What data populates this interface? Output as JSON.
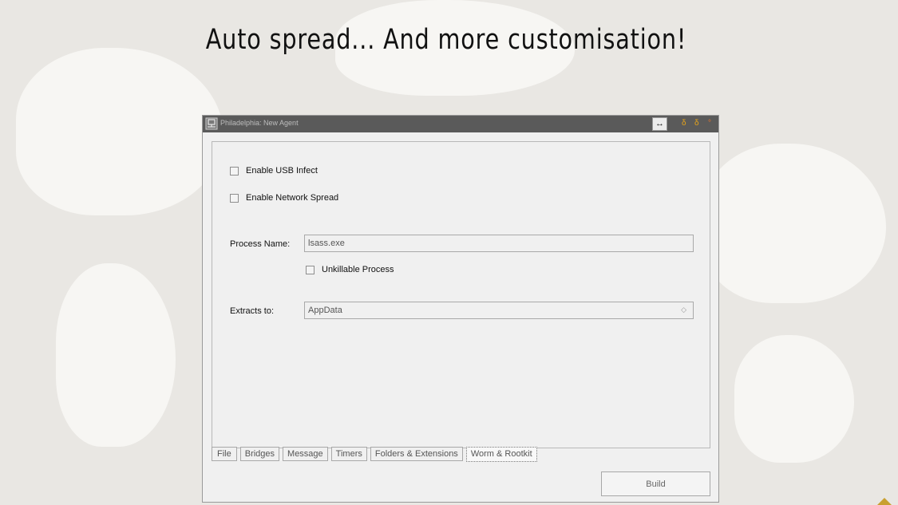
{
  "slide": {
    "title": "Auto spread... And more customisation!"
  },
  "window": {
    "title": "Philadelphia: New Agent",
    "resize_glyph": "↔",
    "min_glyph": "δ",
    "max_glyph": "δ",
    "close_glyph": "°"
  },
  "form": {
    "usb_label": "Enable USB Infect",
    "usb_checked": false,
    "network_label": "Enable Network Spread",
    "network_checked": false,
    "process_name_label": "Process Name:",
    "process_name_value": "lsass.exe",
    "unkillable_label": "Unkillable Process",
    "unkillable_checked": false,
    "extracts_label": "Extracts to:",
    "extracts_value": "AppData",
    "dropdown_arrow": "◇"
  },
  "tabs": [
    {
      "label": "File",
      "active": false
    },
    {
      "label": "Bridges",
      "active": false
    },
    {
      "label": "Message",
      "active": false
    },
    {
      "label": "Timers",
      "active": false
    },
    {
      "label": "Folders & Extensions",
      "active": false
    },
    {
      "label": "Worm & Rootkit",
      "active": true
    }
  ],
  "footer": {
    "build_label": "Build"
  },
  "icons": {
    "app": "app-icon",
    "checkbox": "checkbox-icon",
    "dropdown": "chevron-down-icon",
    "resize": "resize-icon",
    "decoration": "triangle-icon"
  },
  "colors": {
    "titlebar": "#5a5a5a",
    "window_bg": "#f0f0f0",
    "control_orange": "#e6a41a",
    "background": "#e9e7e3"
  }
}
